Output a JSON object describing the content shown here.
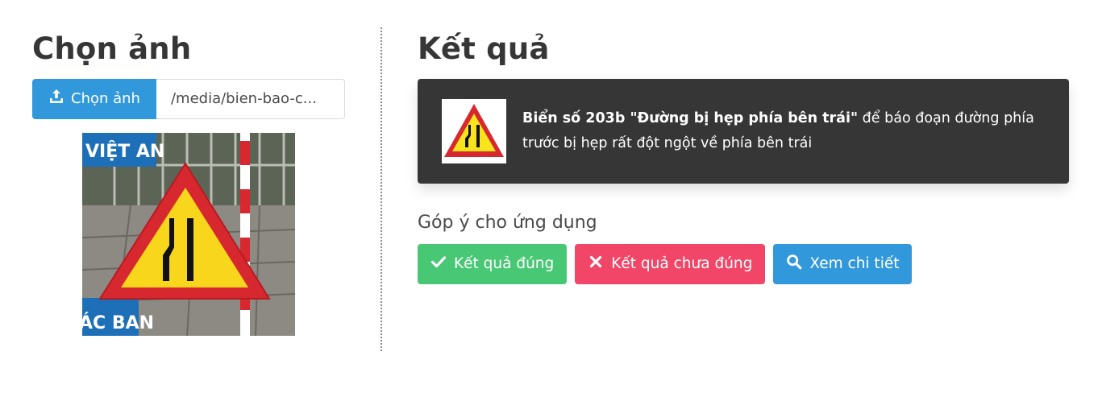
{
  "left": {
    "title": "Chọn ảnh",
    "upload_button_label": "Chọn ảnh",
    "upload_icon": "upload-icon",
    "file_name": "/media/bien-bao-c..."
  },
  "right": {
    "title": "Kết quả",
    "result": {
      "sign_name": "Biển số 203b \"Đường bị hẹp phía bên trái\"",
      "description": " để báo đoạn đường phía trước bị hẹp rất đột ngột về phía bên trái"
    },
    "feedback_title": "Góp ý cho ứng dụng",
    "buttons": {
      "correct_label": "Kết quả đúng",
      "incorrect_label": "Kết quả chưa đúng",
      "details_label": "Xem chi tiết"
    }
  },
  "colors": {
    "primary": "#3298dc",
    "success": "#48c774",
    "danger": "#f14668",
    "card_dark": "#363636",
    "sign_red": "#d7282f",
    "sign_yellow": "#f8e41c"
  },
  "photo_text": {
    "top_banner": "VIỆT AN",
    "bottom_banner": "ÁC BAN"
  }
}
